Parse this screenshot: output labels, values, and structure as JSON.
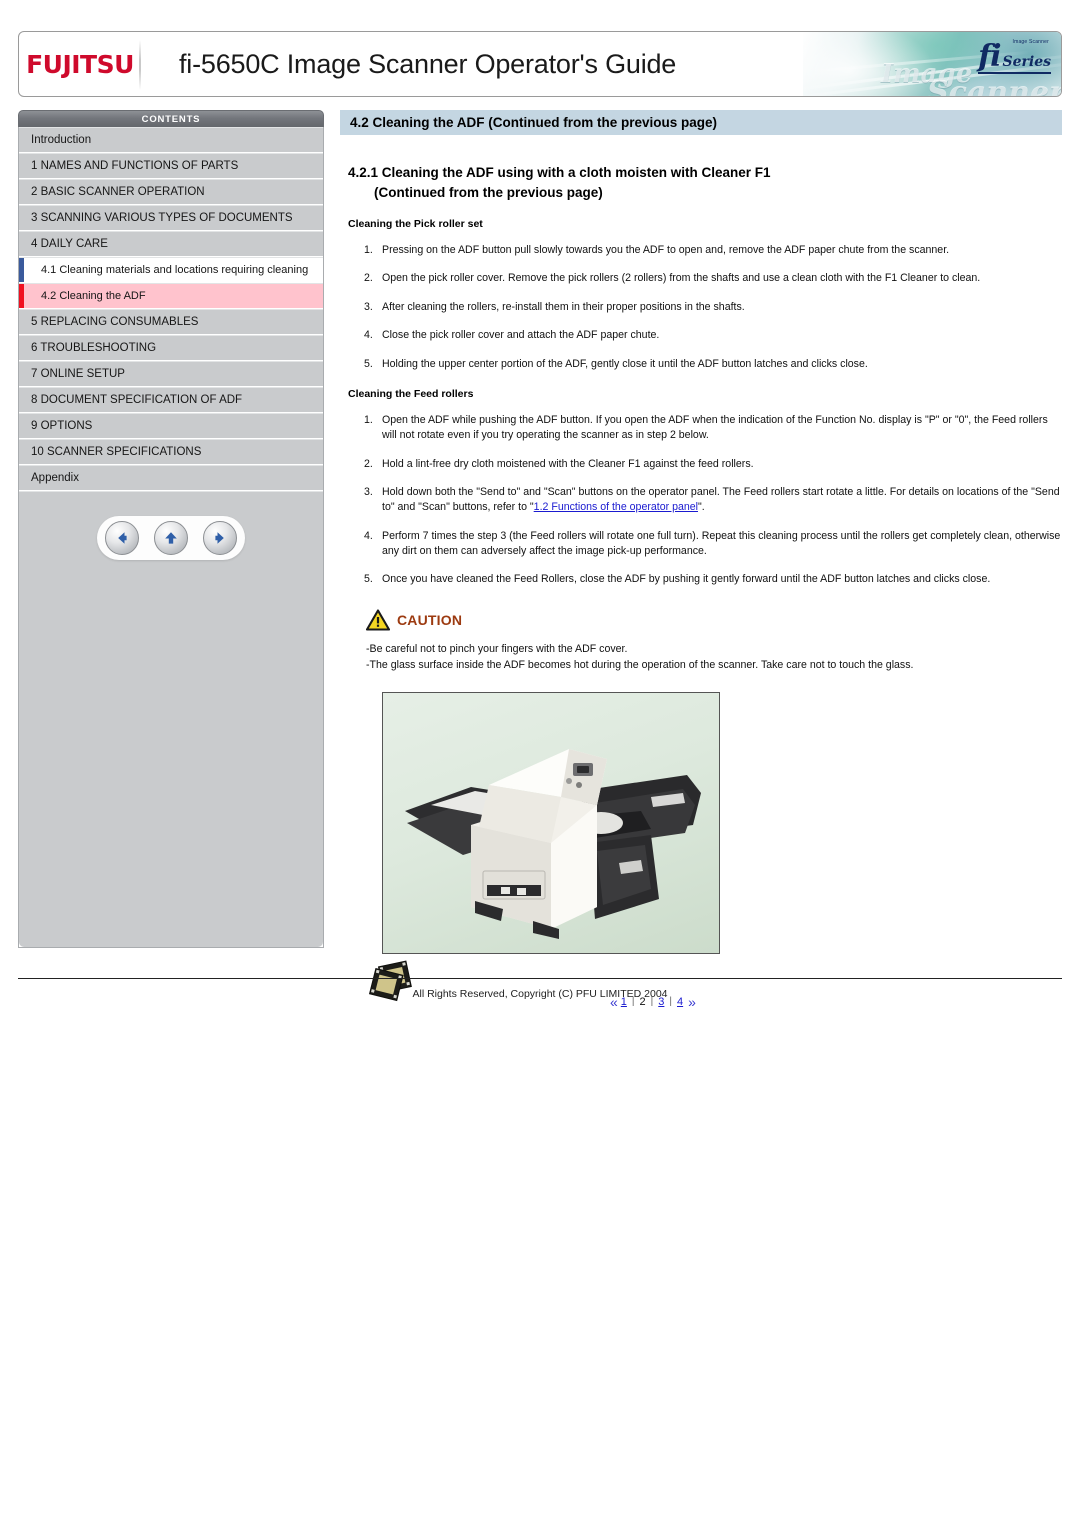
{
  "header": {
    "brand": "FUJITSU",
    "title": "fi-5650C Image Scanner Operator's Guide",
    "banner": {
      "fi": "fi",
      "series": "Series",
      "sub": "Image Scanner",
      "watermark_1": "Image",
      "watermark_2": "Scanner"
    }
  },
  "sidebar": {
    "contents_label": "CONTENTS",
    "items": [
      {
        "label": "Introduction",
        "type": "top"
      },
      {
        "label": "1 NAMES AND FUNCTIONS OF PARTS",
        "type": "top"
      },
      {
        "label": "2 BASIC SCANNER OPERATION",
        "type": "top"
      },
      {
        "label": "3 SCANNING VARIOUS TYPES OF DOCUMENTS",
        "type": "top"
      },
      {
        "label": "4 DAILY CARE",
        "type": "top"
      },
      {
        "label": "4.1 Cleaning materials and locations requiring cleaning",
        "type": "sub-white"
      },
      {
        "label": "4.2 Cleaning the ADF",
        "type": "sub-pink"
      },
      {
        "label": "5 REPLACING CONSUMABLES",
        "type": "top"
      },
      {
        "label": "6 TROUBLESHOOTING",
        "type": "top"
      },
      {
        "label": "7 ONLINE SETUP",
        "type": "top"
      },
      {
        "label": "8 DOCUMENT SPECIFICATION OF ADF",
        "type": "top"
      },
      {
        "label": "9 OPTIONS",
        "type": "top"
      },
      {
        "label": "10 SCANNER SPECIFICATIONS",
        "type": "top"
      },
      {
        "label": "Appendix",
        "type": "top"
      }
    ],
    "nav": {
      "back": "back-arrow",
      "up": "up-arrow",
      "forward": "forward-arrow"
    }
  },
  "main": {
    "section_title": "4.2 Cleaning the ADF (Continued from the previous page)",
    "subsection_title": "4.2.1 Cleaning the ADF using with a cloth moisten with Cleaner F1",
    "subsection_cont": "(Continued from the previous page)",
    "pick_roller": {
      "heading": "Cleaning the Pick roller set",
      "steps": [
        "Pressing on the ADF button pull slowly towards you the ADF to open and, remove the ADF paper chute from the scanner.",
        "Open the pick roller cover. Remove the pick rollers (2 rollers) from the shafts and use a clean cloth with the F1 Cleaner to clean.",
        "After cleaning the rollers, re-install them in their proper positions in the shafts.",
        "Close the pick roller cover and attach the ADF paper chute.",
        "Holding the upper center portion of the ADF, gently close it until the ADF button latches and clicks close."
      ]
    },
    "feed_roller": {
      "heading": "Cleaning the Feed rollers",
      "step1": "Open the ADF while pushing the ADF button. If you open the ADF when the indication of the Function No. display is \"P\" or \"0\", the Feed rollers will not rotate even if you try operating the scanner as in step 2 below.",
      "step2": "Hold a lint-free dry cloth moistened with the Cleaner F1 against the feed rollers.",
      "step3_pre": "Hold down both the \"Send to\" and \"Scan\" buttons on the operator panel. The Feed rollers start rotate a little. For details on locations of the \"Send to\" and \"Scan\" buttons, refer to \"",
      "step3_link": "1.2 Functions of the operator panel",
      "step3_post": "\".",
      "step4": "Perform 7 times the step 3 (the Feed rollers will rotate one full turn). Repeat this cleaning process until the rollers get completely clean, otherwise any dirt on them can adversely affect the image pick-up performance.",
      "step5": "Once you have cleaned the Feed Rollers, close the ADF by pushing it gently forward until the ADF button latches and clicks close."
    },
    "caution": {
      "label": "CAUTION",
      "line1": "-Be careful not to pinch your fingers with the ADF cover.",
      "line2": "-The glass surface inside the ADF becomes hot during the operation of the scanner. Take care not to touch the glass."
    },
    "figure": {
      "alt": "fi-5650C scanner photograph",
      "film_icon": "film-strip-icon"
    },
    "pager": {
      "first": "«",
      "last": "»",
      "pages": [
        "1",
        "2",
        "3",
        "4"
      ],
      "current": "2"
    }
  },
  "footer": {
    "copyright": "All Rights Reserved, Copyright (C) PFU LIMITED 2004"
  },
  "colors": {
    "brand_red": "#cf0a2c",
    "section_band": "#c4d6e2",
    "selected_pink": "#ffc3cd",
    "selected_blue_bar": "#3a5a9c",
    "selected_red_bar": "#f01020",
    "link_blue": "#1a1ad0",
    "caution_text": "#9c3a10",
    "toc_gray": "#c9cbcd"
  }
}
